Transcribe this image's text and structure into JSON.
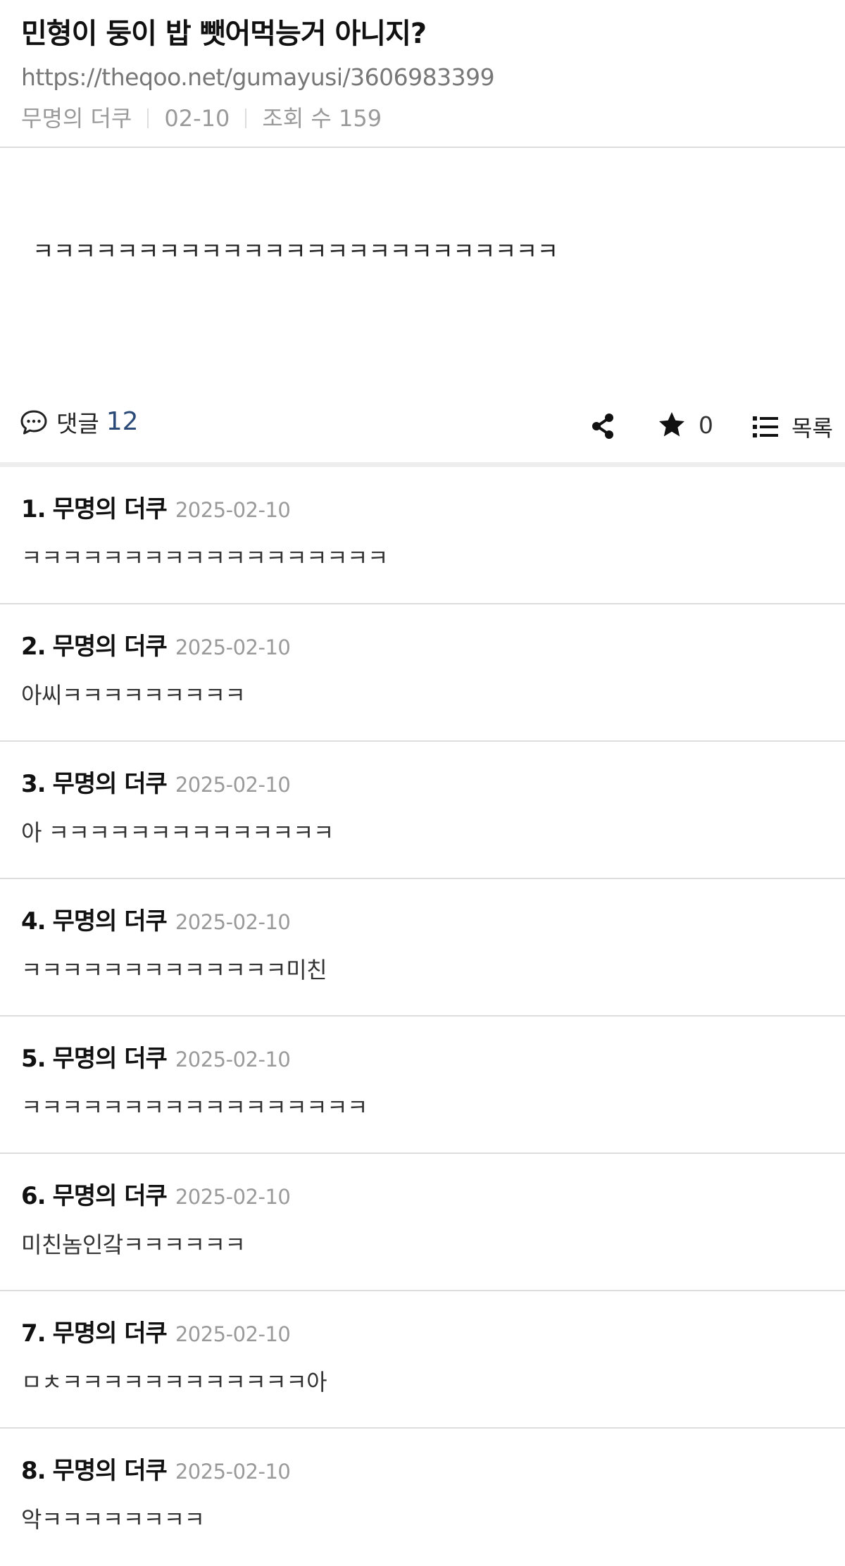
{
  "post": {
    "title": "민형이 둥이 밥 뺏어먹능거 아니지?",
    "url": "https://theqoo.net/gumayusi/3606983399",
    "author": "무명의 더쿠",
    "date": "02-10",
    "views_label": "조회 수 159",
    "body": "ㅋㅋㅋㅋㅋㅋㅋㅋㅋㅋㅋㅋㅋㅋㅋㅋㅋㅋㅋㅋㅋㅋㅋㅋㅋ"
  },
  "actions": {
    "comment_label": "댓글",
    "comment_count": "12",
    "star_count": "0",
    "list_label": "목록",
    "icons": [
      "comment-bubble-icon",
      "share-icon",
      "star-icon",
      "list-icon"
    ]
  },
  "comments": [
    {
      "num": "1.",
      "author": "무명의 더쿠",
      "date": "2025-02-10",
      "text": "ㅋㅋㅋㅋㅋㅋㅋㅋㅋㅋㅋㅋㅋㅋㅋㅋㅋㅋ"
    },
    {
      "num": "2.",
      "author": "무명의 더쿠",
      "date": "2025-02-10",
      "text": "아씨ㅋㅋㅋㅋㅋㅋㅋㅋㅋ"
    },
    {
      "num": "3.",
      "author": "무명의 더쿠",
      "date": "2025-02-10",
      "text": "아 ㅋㅋㅋㅋㅋㅋㅋㅋㅋㅋㅋㅋㅋㅋ"
    },
    {
      "num": "4.",
      "author": "무명의 더쿠",
      "date": "2025-02-10",
      "text": "ㅋㅋㅋㅋㅋㅋㅋㅋㅋㅋㅋㅋㅋ미친"
    },
    {
      "num": "5.",
      "author": "무명의 더쿠",
      "date": "2025-02-10",
      "text": "ㅋㅋㅋㅋㅋㅋㅋㅋㅋㅋㅋㅋㅋㅋㅋㅋㅋ"
    },
    {
      "num": "6.",
      "author": "무명의 더쿠",
      "date": "2025-02-10",
      "text": "미친놈인갘ㅋㅋㅋㅋㅋㅋ"
    },
    {
      "num": "7.",
      "author": "무명의 더쿠",
      "date": "2025-02-10",
      "text": "ㅁㅊㅋㅋㅋㅋㅋㅋㅋㅋㅋㅋㅋㅋ아"
    },
    {
      "num": "8.",
      "author": "무명의 더쿠",
      "date": "2025-02-10",
      "text": "악ㅋㅋㅋㅋㅋㅋㅋㅋ"
    }
  ],
  "colors": {
    "comment_count": "#2c4a78",
    "meta_gray": "#9a9a9a",
    "divider": "#dddddd"
  }
}
